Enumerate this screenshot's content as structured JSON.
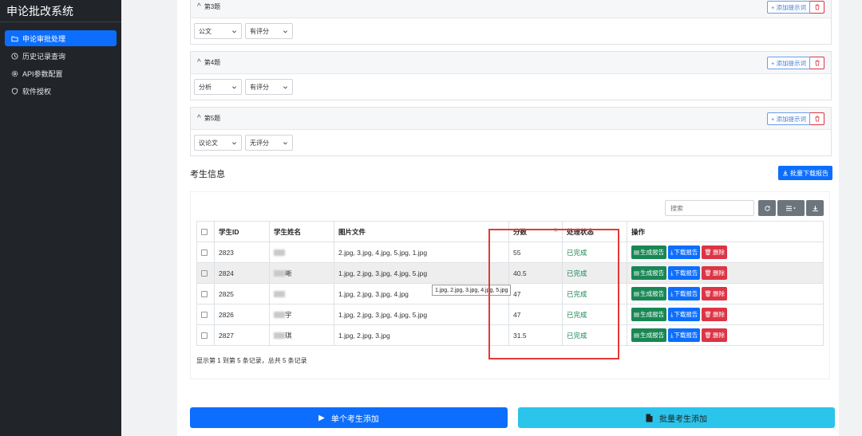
{
  "app_title": "申论批改系统",
  "sidebar": {
    "items": [
      {
        "label": "申论审批处理",
        "icon": "folder-icon",
        "active": true
      },
      {
        "label": "历史记录查询",
        "icon": "clock-icon",
        "active": false
      },
      {
        "label": "API参数配置",
        "icon": "gear-icon",
        "active": false
      },
      {
        "label": "软件授权",
        "icon": "shield-icon",
        "active": false
      }
    ]
  },
  "questions": [
    {
      "title": "第3题",
      "type": "公文",
      "scoring": "有评分",
      "add_label": "添加提示词"
    },
    {
      "title": "第4题",
      "type": "分析",
      "scoring": "有评分",
      "add_label": "添加提示词"
    },
    {
      "title": "第5题",
      "type": "议论文",
      "scoring": "无评分",
      "add_label": "添加提示词"
    }
  ],
  "students_section": {
    "title": "考生信息",
    "batch_download_label": "批量下载报告",
    "search_placeholder": "搜索"
  },
  "table": {
    "headers": [
      "学生ID",
      "学生姓名",
      "图片文件",
      "分数",
      "处理状态",
      "操作"
    ],
    "rows": [
      {
        "id": "2823",
        "name_visible": "",
        "files": "2.jpg, 3.jpg, 4.jpg, 5.jpg, 1.jpg",
        "score": "55",
        "status": "已完成"
      },
      {
        "id": "2824",
        "name_visible": "晰",
        "files": "1.jpg, 2.jpg, 3.jpg, 4.jpg, 5.jpg",
        "score": "40.5",
        "status": "已完成"
      },
      {
        "id": "2825",
        "name_visible": "",
        "files": "1.jpg, 2.jpg, 3.jpg, 4.jpg",
        "score": "47",
        "status": "已完成"
      },
      {
        "id": "2826",
        "name_visible": "宇",
        "files": "1.jpg, 2.jpg, 3.jpg, 4.jpg, 5.jpg",
        "score": "47",
        "status": "已完成"
      },
      {
        "id": "2827",
        "name_visible": "琪",
        "files": "1.jpg, 2.jpg, 3.jpg",
        "score": "31.5",
        "status": "已完成"
      }
    ],
    "actions": {
      "generate": "生成报告",
      "download": "下载报告",
      "delete": "删除"
    },
    "tooltip": "1.jpg, 2.jpg, 3.jpg, 4.jpg, 5.jpg",
    "info": "显示第 1 到第 5 条记录，总共 5 条记录"
  },
  "bottom_buttons": {
    "single_add": "单个考生添加",
    "batch_add": "批量考生添加"
  },
  "colors": {
    "primary": "#0d6efd",
    "success": "#198754",
    "danger": "#dc3545",
    "info": "#2bc4eb",
    "sidebar_bg": "#212529",
    "highlight_box": "#e53935"
  }
}
